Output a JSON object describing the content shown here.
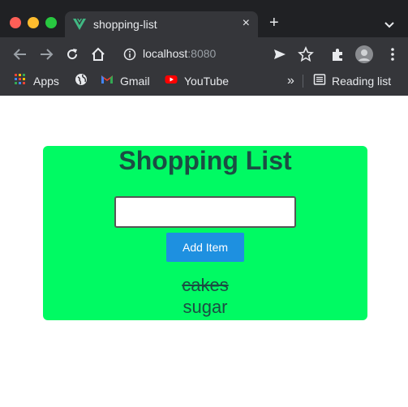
{
  "browser": {
    "tab": {
      "title": "shopping-list",
      "favicon": "vue-logo-icon"
    },
    "url": {
      "host": "localhost",
      "port": ":8080"
    },
    "bookmarks": [
      {
        "label": "Apps",
        "icon": "apps-grid-icon"
      },
      {
        "label": "",
        "icon": "globe-icon"
      },
      {
        "label": "Gmail",
        "icon": "gmail-icon"
      },
      {
        "label": "YouTube",
        "icon": "youtube-icon"
      }
    ],
    "reading_list": "Reading list",
    "overflow": "»"
  },
  "app": {
    "title": "Shopping List",
    "input": {
      "value": "",
      "placeholder": ""
    },
    "add_button": "Add Item",
    "items": [
      {
        "name": "cakes",
        "done": true
      },
      {
        "name": "sugar",
        "done": false
      }
    ]
  },
  "colors": {
    "card_bg": "#00fa63",
    "title_text": "#1b4d43",
    "button_bg": "#1e90e0"
  }
}
